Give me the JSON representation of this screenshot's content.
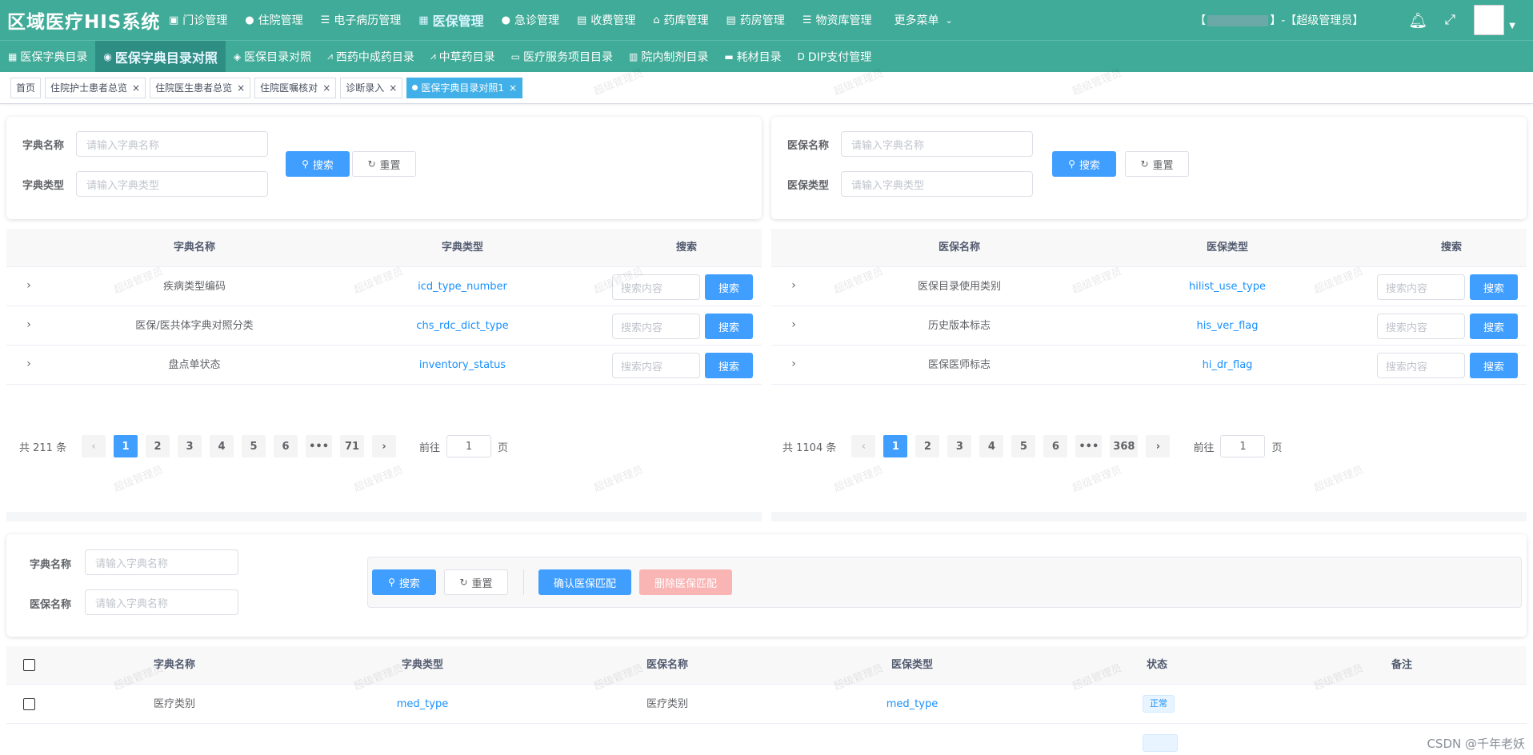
{
  "app": {
    "title": "区域医疗HIS系统"
  },
  "top_menu": [
    {
      "label": "门诊管理",
      "icon": "briefcase-icon"
    },
    {
      "label": "住院管理",
      "icon": "user-bed-icon"
    },
    {
      "label": "电子病历管理",
      "icon": "list-icon"
    },
    {
      "label": "医保管理",
      "icon": "building-icon",
      "active": true
    },
    {
      "label": "急诊管理",
      "icon": "user-icon"
    },
    {
      "label": "收费管理",
      "icon": "document-icon"
    },
    {
      "label": "药库管理",
      "icon": "home-icon"
    },
    {
      "label": "药房管理",
      "icon": "file-icon"
    },
    {
      "label": "物资库管理",
      "icon": "list-icon"
    },
    {
      "label": "更多菜单",
      "icon": "chevron-down-icon"
    }
  ],
  "user": {
    "prefix": "【",
    "middle": "】-【超级管理员】"
  },
  "sub_menu": [
    {
      "label": "医保字典目录",
      "icon": "grid-icon"
    },
    {
      "label": "医保字典目录对照",
      "icon": "medical-icon",
      "active": true
    },
    {
      "label": "医保目录对照",
      "icon": "compare-icon"
    },
    {
      "label": "西药中成药目录",
      "icon": "chart-icon"
    },
    {
      "label": "中草药目录",
      "icon": "chart-line-icon"
    },
    {
      "label": "医疗服务项目目录",
      "icon": "ab-icon"
    },
    {
      "label": "院内制剂目录",
      "icon": "building-icon"
    },
    {
      "label": "耗材目录",
      "icon": "car-icon"
    },
    {
      "label": "DIP支付管理",
      "icon": "d-icon"
    }
  ],
  "tags": [
    {
      "label": "首页",
      "closable": false
    },
    {
      "label": "住院护士患者总览",
      "closable": true
    },
    {
      "label": "住院医生患者总览",
      "closable": true
    },
    {
      "label": "住院医嘱核对",
      "closable": true
    },
    {
      "label": "诊断录入",
      "closable": true
    },
    {
      "label": "医保字典目录对照1",
      "closable": true,
      "active": true
    }
  ],
  "left_search": {
    "name_label": "字典名称",
    "name_placeholder": "请输入字典名称",
    "type_label": "字典类型",
    "type_placeholder": "请输入字典类型",
    "search_label": "搜索",
    "reset_label": "重置"
  },
  "right_search": {
    "name_label": "医保名称",
    "name_placeholder": "请输入字典名称",
    "type_label": "医保类型",
    "type_placeholder": "请输入字典类型",
    "search_label": "搜索",
    "reset_label": "重置"
  },
  "left_table": {
    "headers": [
      "字典名称",
      "字典类型",
      "搜索"
    ],
    "rows": [
      {
        "name": "疾病类型编码",
        "type": "icd_type_number"
      },
      {
        "name": "医保/医共体字典对照分类",
        "type": "chs_rdc_dict_type"
      },
      {
        "name": "盘点单状态",
        "type": "inventory_status"
      }
    ],
    "row_placeholder": "搜索内容",
    "row_button": "搜索",
    "pager": {
      "total": "共 211 条",
      "pages": [
        "1",
        "2",
        "3",
        "4",
        "5",
        "6",
        "•••",
        "71"
      ],
      "goto": "前往",
      "current": "1",
      "page_unit": "页",
      "prev": "‹",
      "next": "›"
    }
  },
  "right_table": {
    "headers": [
      "医保名称",
      "医保类型",
      "搜索"
    ],
    "rows": [
      {
        "name": "医保目录使用类别",
        "type": "hilist_use_type"
      },
      {
        "name": "历史版本标志",
        "type": "his_ver_flag"
      },
      {
        "name": "医保医师标志",
        "type": "hi_dr_flag"
      }
    ],
    "row_placeholder": "搜索内容",
    "row_button": "搜索",
    "pager": {
      "total": "共 1104 条",
      "pages": [
        "1",
        "2",
        "3",
        "4",
        "5",
        "6",
        "•••",
        "368"
      ],
      "goto": "前往",
      "current": "1",
      "page_unit": "页",
      "prev": "‹",
      "next": "›"
    }
  },
  "bottom_search": {
    "name_label": "字典名称",
    "name_placeholder": "请输入字典名称",
    "ins_label": "医保名称",
    "ins_placeholder": "请输入字典名称",
    "search_label": "搜索",
    "reset_label": "重置",
    "confirm_label": "确认医保匹配",
    "delete_label": "删除医保匹配"
  },
  "bottom_table": {
    "headers": [
      "字典名称",
      "字典类型",
      "医保名称",
      "医保类型",
      "状态",
      "备注"
    ],
    "rows": [
      {
        "dict_name": "医疗类别",
        "dict_type": "med_type",
        "ins_name": "医疗类别",
        "ins_type": "med_type",
        "status": "正常",
        "note": ""
      }
    ]
  },
  "watermark_text": "超级管理员",
  "footer_credit": "CSDN @千年老妖"
}
